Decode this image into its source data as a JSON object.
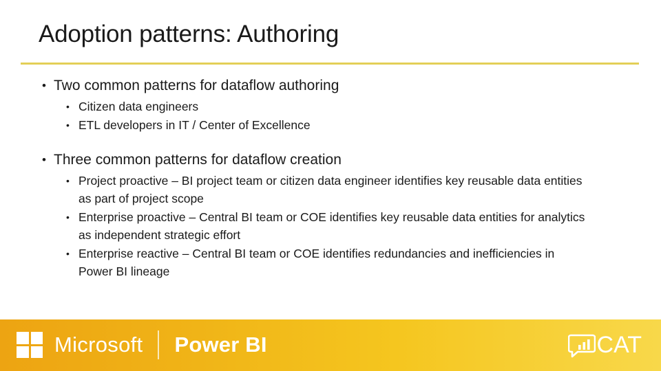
{
  "slide": {
    "title": "Adoption patterns: Authoring",
    "rule_color": "#e3cf57",
    "sections": [
      {
        "heading": "Two common patterns for dataflow authoring",
        "bullet_glyph": "•",
        "items": [
          "Citizen data engineers",
          "ETL developers in IT / Center of Excellence"
        ]
      },
      {
        "heading": "Three common patterns for dataflow creation",
        "bullet_glyph": "•",
        "items": [
          "Project proactive – BI project team or citizen data engineer identifies key reusable data entities as part of project scope",
          "Enterprise proactive – Central BI team or COE identifies key reusable data entities for analytics as independent strategic effort",
          "Enterprise reactive – Central BI team or COE identifies redundancies and inefficiencies in Power BI lineage"
        ]
      }
    ]
  },
  "footer": {
    "microsoft_label": "Microsoft",
    "product_label": "Power BI",
    "cat_label": "CAT",
    "logo_icon": "microsoft-squares-icon",
    "cat_icon": "powerbi-cat-speech-bubble-chart-icon",
    "band_color_start": "#eda412",
    "band_color_end": "#f8d84a",
    "text_color": "#ffffff"
  }
}
